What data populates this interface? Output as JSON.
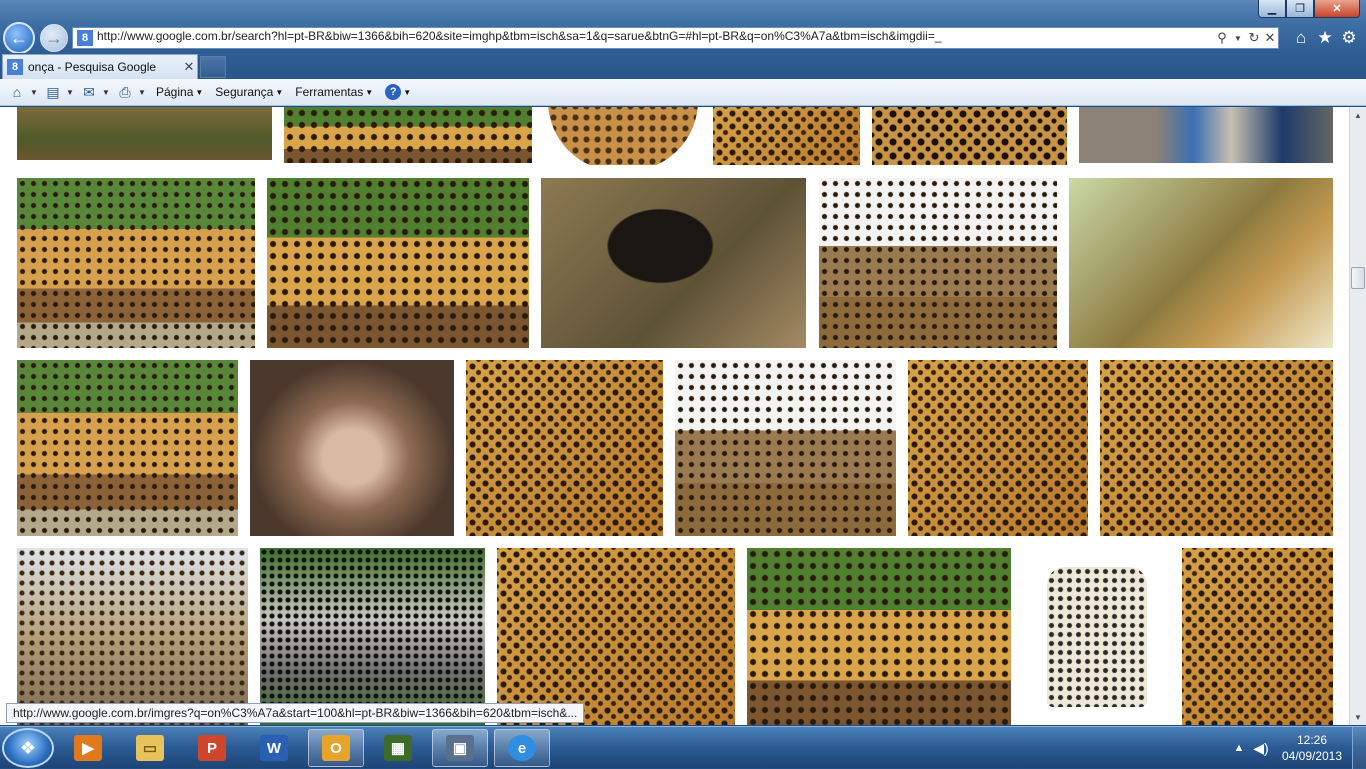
{
  "browser": {
    "address": "http://www.google.com.br/search?hl=pt-BR&biw=1366&bih=620&site=imghp&tbm=isch&sa=1&q=sarue&btnG=#hl=pt-BR&q=on%C3%A7a&tbm=isch&imgdii=_",
    "tab_title": "onça - Pesquisa Google",
    "favicon": "8",
    "window_controls": {
      "minimize": "▁",
      "maximize": "❐",
      "close": "✕"
    }
  },
  "commandbar": {
    "pagina": "Página",
    "seguranca": "Segurança",
    "ferramentas": "Ferramentas",
    "help": "?"
  },
  "results": {
    "images": [
      {
        "name": "image-r0-0",
        "style": "grass-top"
      },
      {
        "name": "image-r0-1",
        "style": "jag-green"
      },
      {
        "name": "image-r0-2",
        "style": "ball"
      },
      {
        "name": "image-r0-3",
        "style": "jag"
      },
      {
        "name": "image-r0-4",
        "style": "pattern"
      },
      {
        "name": "image-r0-5",
        "style": "misc"
      },
      {
        "name": "image-r1-0",
        "style": "log"
      },
      {
        "name": "image-r1-1",
        "style": "jag-green"
      },
      {
        "name": "image-r1-2",
        "style": "panther"
      },
      {
        "name": "image-r1-3",
        "style": "snow-leo"
      },
      {
        "name": "image-r1-4",
        "style": "puma-tree"
      },
      {
        "name": "image-r2-0",
        "style": "log"
      },
      {
        "name": "image-r2-1",
        "style": "puma"
      },
      {
        "name": "image-r2-2",
        "style": "jag"
      },
      {
        "name": "image-r2-3",
        "style": "snow-leo"
      },
      {
        "name": "image-r2-4",
        "style": "jag"
      },
      {
        "name": "image-r2-5",
        "style": "jag"
      },
      {
        "name": "image-r3-0",
        "style": "sky-leo"
      },
      {
        "name": "image-r3-1",
        "style": "cubs"
      },
      {
        "name": "image-r3-2",
        "style": "jag"
      },
      {
        "name": "image-r3-3",
        "style": "jag-green"
      },
      {
        "name": "image-r3-4",
        "style": "jacket"
      },
      {
        "name": "image-r3-5",
        "style": "jag"
      }
    ]
  },
  "status_url": "http://www.google.com.br/imgres?q=on%C3%A7a&start=100&hl=pt-BR&biw=1366&bih=620&tbm=isch&...",
  "taskbar": {
    "time": "12:26",
    "date": "04/09/2013"
  },
  "colors": {
    "taskbar": "#2b5a93",
    "titlebar": "#3e6ea3",
    "close": "#c7432a"
  }
}
